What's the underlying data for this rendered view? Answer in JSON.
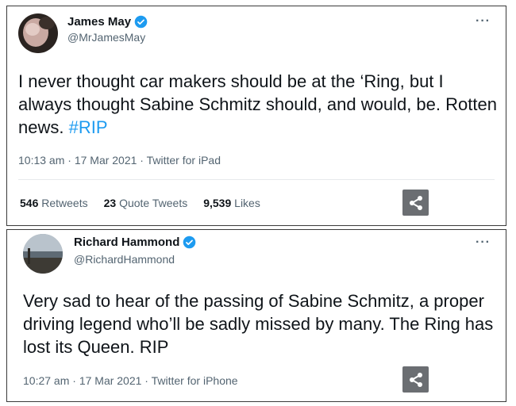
{
  "tweet1": {
    "display_name": "James May",
    "handle": "@MrJamesMay",
    "text_main": "I never thought car makers should be at the ‘Ring, but I always thought Sabine Schmitz should, and would, be. Rotten news. ",
    "hashtag": "#RIP",
    "timestamp": "10:13 am · 17 Mar 2021 · Twitter for iPad",
    "retweets_count": "546",
    "retweets_label": "Retweets",
    "quote_count": "23",
    "quote_label": "Quote Tweets",
    "likes_count": "9,539",
    "likes_label": "Likes",
    "more_label": "···",
    "icons": [
      "avatar",
      "verified-badge-icon",
      "more-icon",
      "share-icon"
    ]
  },
  "tweet2": {
    "display_name": "Richard Hammond",
    "handle": "@RichardHammond",
    "text_main": "Very sad to hear of the passing of Sabine Schmitz, a proper driving legend who’ll be sadly missed by many. The Ring has lost its Queen. RIP",
    "timestamp": "10:27 am · 17 Mar 2021 · Twitter for iPhone",
    "more_label": "···",
    "icons": [
      "avatar",
      "verified-badge-icon",
      "more-icon",
      "share-icon"
    ]
  },
  "colors": {
    "verified": "#1d9bf0",
    "hashtag": "#1d9bf0",
    "secondary_text": "#536471",
    "share_button": "#6b6e72"
  }
}
